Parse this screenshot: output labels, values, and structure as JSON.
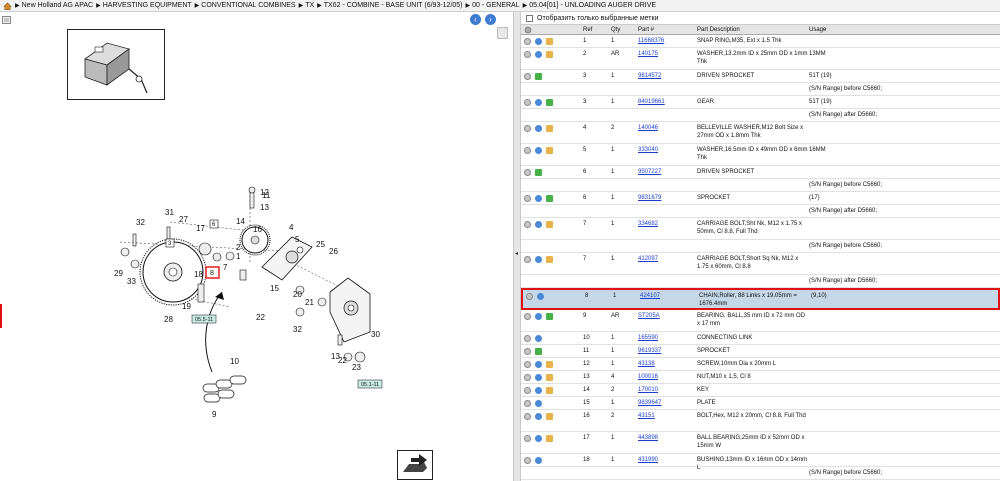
{
  "breadcrumb": [
    "New Holland AG APAC",
    "HARVESTING EQUIPMENT",
    "CONVENTIONAL COMBINES",
    "TX",
    "TX62 - COMBINE - BASE UNIT (6/93-12/05)",
    "00 - GENERAL",
    "05.04[01] - UNLOADING AUGER DRIVE"
  ],
  "filter_label": "Отобразить только выбранные метки",
  "columns": [
    "Ref",
    "Qty",
    "Part #",
    "Part Description",
    "Usage"
  ],
  "diagram": {
    "callouts": [
      "1",
      "2",
      "3",
      "4",
      "5",
      "6",
      "7",
      "8",
      "9",
      "10",
      "11",
      "12",
      "13",
      "14",
      "15",
      "16",
      "17",
      "18",
      "19",
      "20",
      "21",
      "22",
      "23",
      "25",
      "26",
      "27",
      "28",
      "29",
      "30",
      "31",
      "32",
      "33"
    ],
    "ref_tags": [
      "05.5-11",
      "05.1-11"
    ]
  },
  "parts": [
    {
      "icons": [
        "info",
        "box"
      ],
      "ref": "1",
      "qty": "1",
      "part": "11668376",
      "desc": "SNAP RING,M35, Ext x 1.5 Thk",
      "usage": ""
    },
    {
      "icons": [
        "info",
        "box"
      ],
      "ref": "2",
      "qty": "AR",
      "part": "140175",
      "desc": "WASHER,13.2mm ID x 25mm OD x 1mm Thk",
      "usage": "13MM"
    },
    {
      "icons": [
        "arrow"
      ],
      "ref": "3",
      "qty": "1",
      "part": "9814572",
      "desc": "DRIVEN SPROCKET",
      "usage": "51T (19)"
    },
    {
      "icons": [],
      "ref": "",
      "qty": "",
      "part": "",
      "desc": "",
      "usage": "(S/N Range) before C5660;"
    },
    {
      "icons": [
        "info",
        "arrow"
      ],
      "ref": "3",
      "qty": "1",
      "part": "84019661",
      "desc": "GEAR",
      "usage": "51T (19)"
    },
    {
      "icons": [],
      "ref": "",
      "qty": "",
      "part": "",
      "desc": "",
      "usage": "(S/N Range) after D5660;"
    },
    {
      "icons": [
        "info",
        "box"
      ],
      "ref": "4",
      "qty": "2",
      "part": "140046",
      "desc": "BELLEVILLE WASHER,M12 Bolt Size x 27mm OD x 1.8mm Thk",
      "usage": ""
    },
    {
      "icons": [
        "info",
        "box"
      ],
      "ref": "5",
      "qty": "1",
      "part": "333040",
      "desc": "WASHER,16.5mm ID x 49mm OD x 6mm Thk",
      "usage": "16MM"
    },
    {
      "icons": [
        "arrow"
      ],
      "ref": "6",
      "qty": "1",
      "part": "9507227",
      "desc": "DRIVEN SPROCKET",
      "usage": ""
    },
    {
      "icons": [],
      "ref": "",
      "qty": "",
      "part": "",
      "desc": "",
      "usage": "(S/N Range) before C5660;"
    },
    {
      "icons": [
        "info",
        "arrow"
      ],
      "ref": "6",
      "qty": "1",
      "part": "9831679",
      "desc": "SPROCKET",
      "usage": "(17)"
    },
    {
      "icons": [],
      "ref": "",
      "qty": "",
      "part": "",
      "desc": "",
      "usage": "(S/N Range) after D5660;"
    },
    {
      "icons": [
        "info",
        "box"
      ],
      "ref": "7",
      "qty": "1",
      "part": "334682",
      "desc": "CARRIAGE BOLT,Sht Nk, M12 x 1.75 x 50mm, Cl 8.8, Full Thd",
      "usage": ""
    },
    {
      "icons": [],
      "ref": "",
      "qty": "",
      "part": "",
      "desc": "",
      "usage": "(S/N Range) before C5660;"
    },
    {
      "icons": [
        "info",
        "box"
      ],
      "ref": "7",
      "qty": "1",
      "part": "412097",
      "desc": "CARRIAGE BOLT,Short Sq Nk, M12 x 1.75 x 60mm, Cl 8.8",
      "usage": ""
    },
    {
      "icons": [],
      "ref": "",
      "qty": "",
      "part": "",
      "desc": "",
      "usage": "(S/N Range) after D5660;"
    },
    {
      "icons": [
        "info"
      ],
      "ref": "8",
      "qty": "1",
      "part": "424107",
      "desc": "CHAIN,Roller, 88 Links x 19.05mm = 1676.4mm",
      "usage": "(9,10)",
      "selected": true
    },
    {
      "icons": [
        "info",
        "arrow"
      ],
      "ref": "9",
      "qty": "AR",
      "part": "ST205A",
      "desc": "BEARING, BALL,35 mm ID x 72 mm OD x 17 mm",
      "usage": ""
    },
    {
      "icons": [
        "info"
      ],
      "ref": "10",
      "qty": "1",
      "part": "165590",
      "desc": "CONNECTING LINK",
      "usage": ""
    },
    {
      "icons": [
        "arrow"
      ],
      "ref": "11",
      "qty": "1",
      "part": "9619337",
      "desc": "SPROCKET",
      "usage": ""
    },
    {
      "icons": [
        "info",
        "box"
      ],
      "ref": "12",
      "qty": "1",
      "part": "43138",
      "desc": "SCREW,10mm Dia x 20mm L",
      "usage": ""
    },
    {
      "icons": [
        "info",
        "box"
      ],
      "ref": "13",
      "qty": "4",
      "part": "100016",
      "desc": "NUT,M10 x 1.5, Cl 8",
      "usage": ""
    },
    {
      "icons": [
        "info",
        "box"
      ],
      "ref": "14",
      "qty": "2",
      "part": "170010",
      "desc": "KEY",
      "usage": ""
    },
    {
      "icons": [
        "info"
      ],
      "ref": "15",
      "qty": "1",
      "part": "9839647",
      "desc": "PLATE",
      "usage": ""
    },
    {
      "icons": [
        "info",
        "box"
      ],
      "ref": "16",
      "qty": "2",
      "part": "43151",
      "desc": "BOLT,Hex, M12 x 20mm, Cl 8.8, Full Thd",
      "usage": ""
    },
    {
      "icons": [
        "info",
        "box"
      ],
      "ref": "17",
      "qty": "1",
      "part": "443898",
      "desc": "BALL BEARING,25mm ID x 52mm OD x 15mm W",
      "usage": ""
    },
    {
      "icons": [
        "info"
      ],
      "ref": "18",
      "qty": "1",
      "part": "431990",
      "desc": "BUSHING,13mm ID x 16mm OD x 14mm L",
      "usage": ""
    },
    {
      "icons": [],
      "ref": "",
      "qty": "",
      "part": "",
      "desc": "",
      "usage": "(S/N Range) before C5660;"
    }
  ],
  "colors": {
    "selected_bg": "#c4d8e8",
    "selected_border": "#e01010",
    "link": "#1a3fd0"
  }
}
